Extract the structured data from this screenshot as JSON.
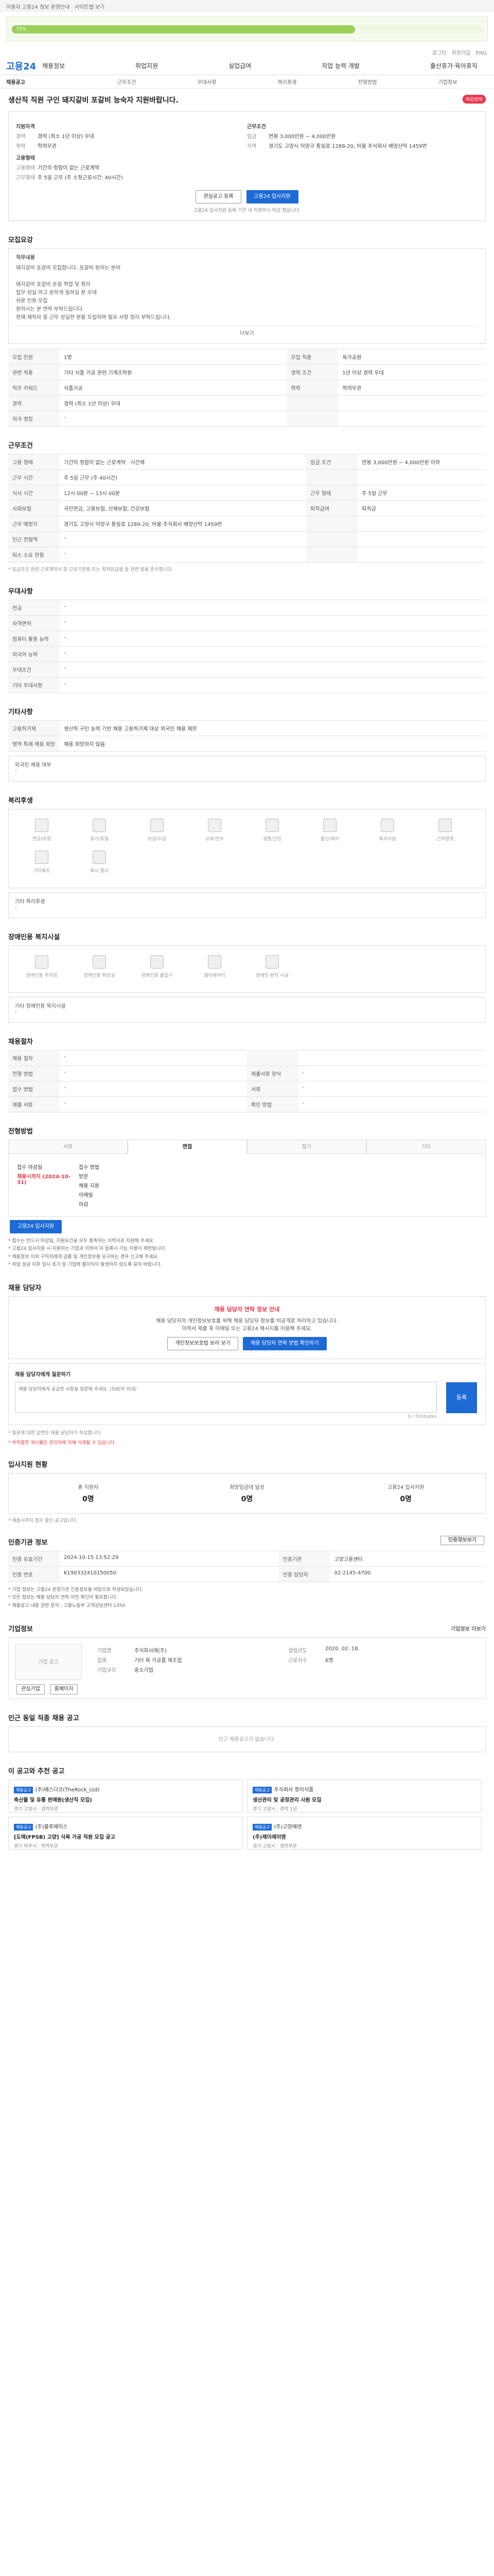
{
  "topbar": {
    "text": "이용자 고용24 정보 운영안내 · 사이트맵 보기"
  },
  "banner": {
    "progress": 0.73,
    "label": "73%"
  },
  "utils": {
    "items": [
      "로그인",
      "회원가입",
      "ENG"
    ]
  },
  "header": {
    "logo": "고용24",
    "gnb": [
      "채용정보",
      "취업지원",
      "실업급여",
      "직업 능력 개발",
      "출산휴가·육아휴직"
    ]
  },
  "subnav": [
    "채용공고",
    "근무조건",
    "우대사항",
    "복리후생",
    "전형방법",
    "기업정보"
  ],
  "title": {
    "text": "생산직 직원 구인 돼지갈비 포갈비 능숙자 지원바랍니다.",
    "badge": "마감임박"
  },
  "summary": {
    "left_title": "지원자격",
    "left": [
      {
        "k": "경력",
        "v": "경력 (최소 1년 이상) 우대"
      },
      {
        "k": "학력",
        "v": "학력무관"
      }
    ],
    "right_title": "근무조건",
    "right": [
      {
        "k": "임금",
        "v": "연봉 3,000만원 ~ 4,000만원"
      },
      {
        "k": "지역",
        "v": "경기도 고양시 덕양구 통일로 1289-20, 어울 주식회사 배양산막 1459번"
      }
    ],
    "left2_title": "고용형태",
    "left2": [
      {
        "k": "고용형태",
        "v": "기간의 정함이 없는 근로계약"
      },
      {
        "k": "근무형태",
        "v": "주 5일 근무 (주 소정근로시간: 40시간)"
      }
    ],
    "btn_interest": "관심공고 등록",
    "btn_apply": "고용24 입사지원",
    "note": "고용24 입사지원 등록 기간 내 지원하시 마감 했습니다."
  },
  "recruit": {
    "title": "모집요강",
    "content_head": "직무내용",
    "content_lines": [
      "돼지갈비 포갈비 모집합니다. 포갈비 원하는 분야",
      "",
      "돼지갈비 포갈비 손질 작업 및 정리",
      "업무 성실 하고 분하게 일하실 분 우대",
      "쉬운 인원 모집",
      "원하시는 분 연락 부탁드립니다.",
      "현재 재직자 중 근무 성실한 분을 모집하며 필요 사항 정리 부탁드립니다."
    ],
    "more": "더보기",
    "rows": [
      [
        {
          "k": "모집 인원",
          "v": "1명"
        },
        {
          "k": "모집 직종",
          "v": "육가공원"
        }
      ],
      [
        {
          "k": "관련 직종",
          "v": "기타 식품 가공 관련 기계조작원"
        },
        {
          "k": "경력 조건",
          "v": "1년 이상 경력 우대"
        }
      ],
      [
        {
          "k": "직무 키워드",
          "v": "식품가공"
        },
        {
          "k": "학력",
          "v": "학력무관"
        }
      ],
      [
        {
          "k": "경력",
          "v": "경력 (최소 1년 이상) 우대"
        },
        {
          "k": "",
          "v": ""
        }
      ],
      [
        {
          "k": "외국 명칭",
          "v": "-"
        },
        {
          "k": "",
          "v": ""
        }
      ]
    ]
  },
  "condition": {
    "title": "근무조건",
    "rows": [
      [
        {
          "k": "고용 형태",
          "v": "기간의 정함이 없는 근로계약 · 시간제"
        },
        {
          "k": "임금 조건",
          "v": "연봉 3,000만원 ~ 4,000만원 이하"
        }
      ],
      [
        {
          "k": "근무 시간",
          "v": "주 5일 근무 (주 40시간)"
        },
        {
          "k": "",
          "v": ""
        }
      ],
      [
        {
          "k": "식사 시간",
          "v": "12시 00분 ~ 13시 00분"
        },
        {
          "k": "근무 형태",
          "v": "주 5일 근무"
        }
      ],
      [
        {
          "k": "사회보험",
          "v": "국민연금, 고용보험, 산재보험, 건강보험"
        },
        {
          "k": "퇴직급여",
          "v": "퇴직금"
        }
      ],
      [
        {
          "k": "근무 예정지",
          "v": "경기도 고양시 덕양구 통일로 1289-20, 어울 주식회사 배양산막 1459번"
        },
        {
          "k": "",
          "v": ""
        }
      ],
      [
        {
          "k": "인근 전철역",
          "v": "-"
        },
        {
          "k": "",
          "v": ""
        }
      ],
      [
        {
          "k": "퇴소 소요 현황",
          "v": "-"
        },
        {
          "k": "",
          "v": ""
        }
      ]
    ],
    "note": "* 임금조건 관련 근로계약시 항 근로기준법 또는 최저임금법 등 관련 법을 준수합니다."
  },
  "preference": {
    "title": "우대사항",
    "rows": [
      [
        {
          "k": "전공",
          "v": "-"
        }
      ],
      [
        {
          "k": "자격면허",
          "v": "-"
        }
      ],
      [
        {
          "k": "컴퓨터 활용 능력",
          "v": "-"
        }
      ],
      [
        {
          "k": "외국어 능력",
          "v": "-"
        }
      ],
      [
        {
          "k": "우대조건",
          "v": "-"
        }
      ],
      [
        {
          "k": "기타 우대사항",
          "v": "-"
        }
      ]
    ]
  },
  "etc": {
    "title": "기타사항",
    "rows": [
      [
        {
          "k": "고용허가제",
          "v": "생산직 구인 능력 기반 채용 고용허가제 대상 외국인 채용 제한"
        }
      ],
      [
        {
          "k": "병역 특례 채용 희망",
          "v": "채용 희망하지 않음"
        }
      ]
    ],
    "foreign": "외국인 채용 여부",
    "foreign_v": "-"
  },
  "welfare": {
    "title": "복리후생",
    "items": [
      "연금/보험",
      "휴가/휴일",
      "보상/수당",
      "교육/연수",
      "생활/건강",
      "출산/육아",
      "복지시설",
      "근무환경",
      "기타복지",
      "회사 행사"
    ],
    "other_label": "기타 복리후생",
    "other_v": "-"
  },
  "disabled": {
    "title": "장애인용 복지시설",
    "items": [
      "장애인용 주차장",
      "장애인용 화장실",
      "장애인용 출입구",
      "엘리베이터",
      "장애인 편의 시설"
    ],
    "other_label": "기타 장애인용 복지시설",
    "other_v": "-"
  },
  "process": {
    "title": "채용절차",
    "rows": [
      [
        {
          "k": "채용 절차",
          "v": "-"
        },
        {
          "k": "",
          "v": ""
        }
      ],
      [
        {
          "k": "전형 방법",
          "v": "-"
        },
        {
          "k": "제출서류 양식",
          "v": "-"
        }
      ],
      [
        {
          "k": "접수 방법",
          "v": "-"
        },
        {
          "k": "서류",
          "v": "-"
        }
      ],
      [
        {
          "k": "제출 서류",
          "v": "-"
        },
        {
          "k": "확인 방법",
          "v": "-"
        }
      ]
    ]
  },
  "apply": {
    "title": "전형방법",
    "tabs": [
      "서류",
      "면접",
      "필기",
      "기타"
    ],
    "col1": [
      "접수 마감일",
      "채용시까지 (2024-10-31)"
    ],
    "col2": [
      "접수 방법",
      "방문",
      "채용 지원",
      "이메일",
      "마감"
    ],
    "btn": "고용24 입사지원",
    "bullets": [
      "* 접수는 반드시 마감일, 지원요건을 모두 충족하는 이력서로 지원해 주세요.",
      "* 고용24 입사지원 시 지원하는 기업과 이력서 미 등록시 기능 이용이 제한됩니다.",
      "* 채용정보 이외 구직자에게 금품 및 개인정보를 요구하는 경우 신고해 주세요.",
      "* 취업 성공 이후 입사 포기 등 기업에 불이익이 발생하지 않도록 유의 바랍니다."
    ]
  },
  "contact": {
    "title": "채용 담당자",
    "alert_title": "채용 담당자 연락 정보 안내",
    "alert_text": "채용 담당자의 개인정보보호를 위해 채용 담당자 정보를 비공개로 처리하고 있습니다.",
    "alert_text2": "이력서 제출 후 이메일 또는 고용24 메시지를 이용해 주세요.",
    "btn1": "개인정보보호법 보러 보기",
    "btn2": "채용 담당자 연락 방법 확인하기"
  },
  "qa": {
    "title": "채용 담당자에게 질문하기",
    "placeholder": "채용 담당자에게 궁금한 사항을 질문해 주세요. (500자 이내)",
    "count": "0 / 500bytes",
    "btn": "등록",
    "note": "* 질문에 대한 답변은 채용 담당자가 작성합니다.",
    "link": "* 부적절한 게시물은 관리자에 의해 삭제될 수 있습니다."
  },
  "status": {
    "title": "입사지원 현황",
    "items": [
      {
        "label": "총 지원자",
        "val": "0명"
      },
      {
        "label": "희망임금대 달성",
        "val": "0명"
      },
      {
        "label": "고용24 입사지원",
        "val": "0명"
      }
    ],
    "note": "* 채용시까지 접수 중인 공고입니다."
  },
  "notice": {
    "title": "인증기관 정보",
    "btn": "인증정보보기",
    "rows": [
      [
        {
          "k": "인증 유효기간",
          "v": "2024-10-15 13:52:29"
        },
        {
          "k": "인증기관",
          "v": "고양고용센터"
        }
      ],
      [
        {
          "k": "인증 번호",
          "v": "K190332410150050"
        },
        {
          "k": "인증 담당자",
          "v": "02-2145-4700"
        }
      ]
    ],
    "bullets": [
      "* 기업 정보는 고용24 운영기관 인증정보를 바탕으로 작성되었습니다.",
      "* 모든 정보는 채용 담당자 연락 이전 확인이 필요합니다.",
      "* 채용공고 내용 관련 문의 : 고용노동부 고객상담센터 1350"
    ]
  },
  "company": {
    "title": "기업정보",
    "more": "기업정보 더보기",
    "logo_alt": "기업 로고",
    "btn1": "관심기업",
    "btn2": "홈페이지",
    "col1": [
      {
        "k": "기업명",
        "v": "주식회사래(주)"
      },
      {
        "k": "업종",
        "v": "기타 육 가공품 제조업"
      },
      {
        "k": "기업규모",
        "v": "중소기업"
      }
    ],
    "col2": [
      {
        "k": "설립년도",
        "v": "2020. 02. 18."
      },
      {
        "k": "근로자수",
        "v": "6명"
      }
    ]
  },
  "similar": {
    "title": "인근 동일 직종 채용 공고",
    "empty": "인근 채용공고가 없습니다."
  },
  "recommend": {
    "title": "이 공고와 추천 공고",
    "cards": [
      {
        "tag": "채용공고",
        "company": "(주)에스다코(TheRock_Ltd)",
        "title": "축산물 및 유통 판매원(생산직 모집)",
        "meta": "경기 고양시 · 경력무관"
      },
      {
        "tag": "채용공고",
        "company": "주식회사 정미식품",
        "title": "생산관리 및 공정관리 사원 모집",
        "meta": "경기 고양시 · 경력 1년"
      },
      {
        "tag": "채용공고",
        "company": "(주)블루에이스",
        "title": "[도매(FPSB) 고양] 식육 가공 직원 모집 공고",
        "meta": "경기 파주시 · 학력무관"
      },
      {
        "tag": "채용공고",
        "company": "(주)고양에덴",
        "title": "(주)제이에이앤",
        "meta": "경기 고양시 · 경력무관"
      }
    ]
  }
}
